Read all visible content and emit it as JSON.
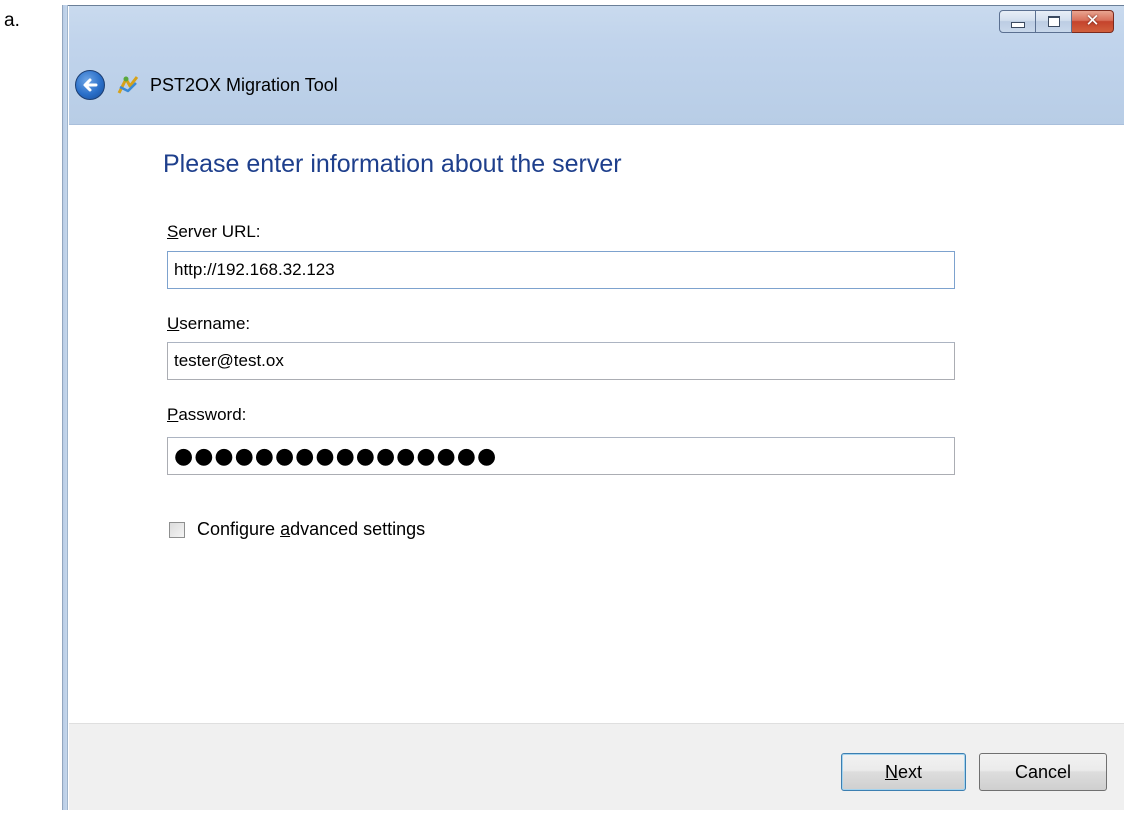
{
  "document": {
    "label": "a."
  },
  "window": {
    "title": "PST2OX Migration Tool",
    "caption_icons": [
      "minimize-icon",
      "maximize-icon",
      "close-icon"
    ],
    "colors": {
      "heading": "#1e3f8c",
      "titlebar": "#c1d4ec",
      "close_button": "#c4432c"
    }
  },
  "form": {
    "heading": "Please enter information about the server",
    "server_url": {
      "label_access_key": "S",
      "label_rest": "erver URL:",
      "value": "http://192.168.32.123"
    },
    "username": {
      "label_access_key": "U",
      "label_rest": "sername:",
      "value": "tester@test.ox"
    },
    "password": {
      "label_access_key": "P",
      "label_rest": "assword:",
      "value": "●●●●●●●●●●●●●●●●"
    },
    "advanced": {
      "label_before": "Configure ",
      "label_access_key": "a",
      "label_after": "dvanced settings",
      "checked": false
    }
  },
  "footer": {
    "next": {
      "access_key": "N",
      "rest": "ext"
    },
    "cancel_label": "Cancel"
  }
}
